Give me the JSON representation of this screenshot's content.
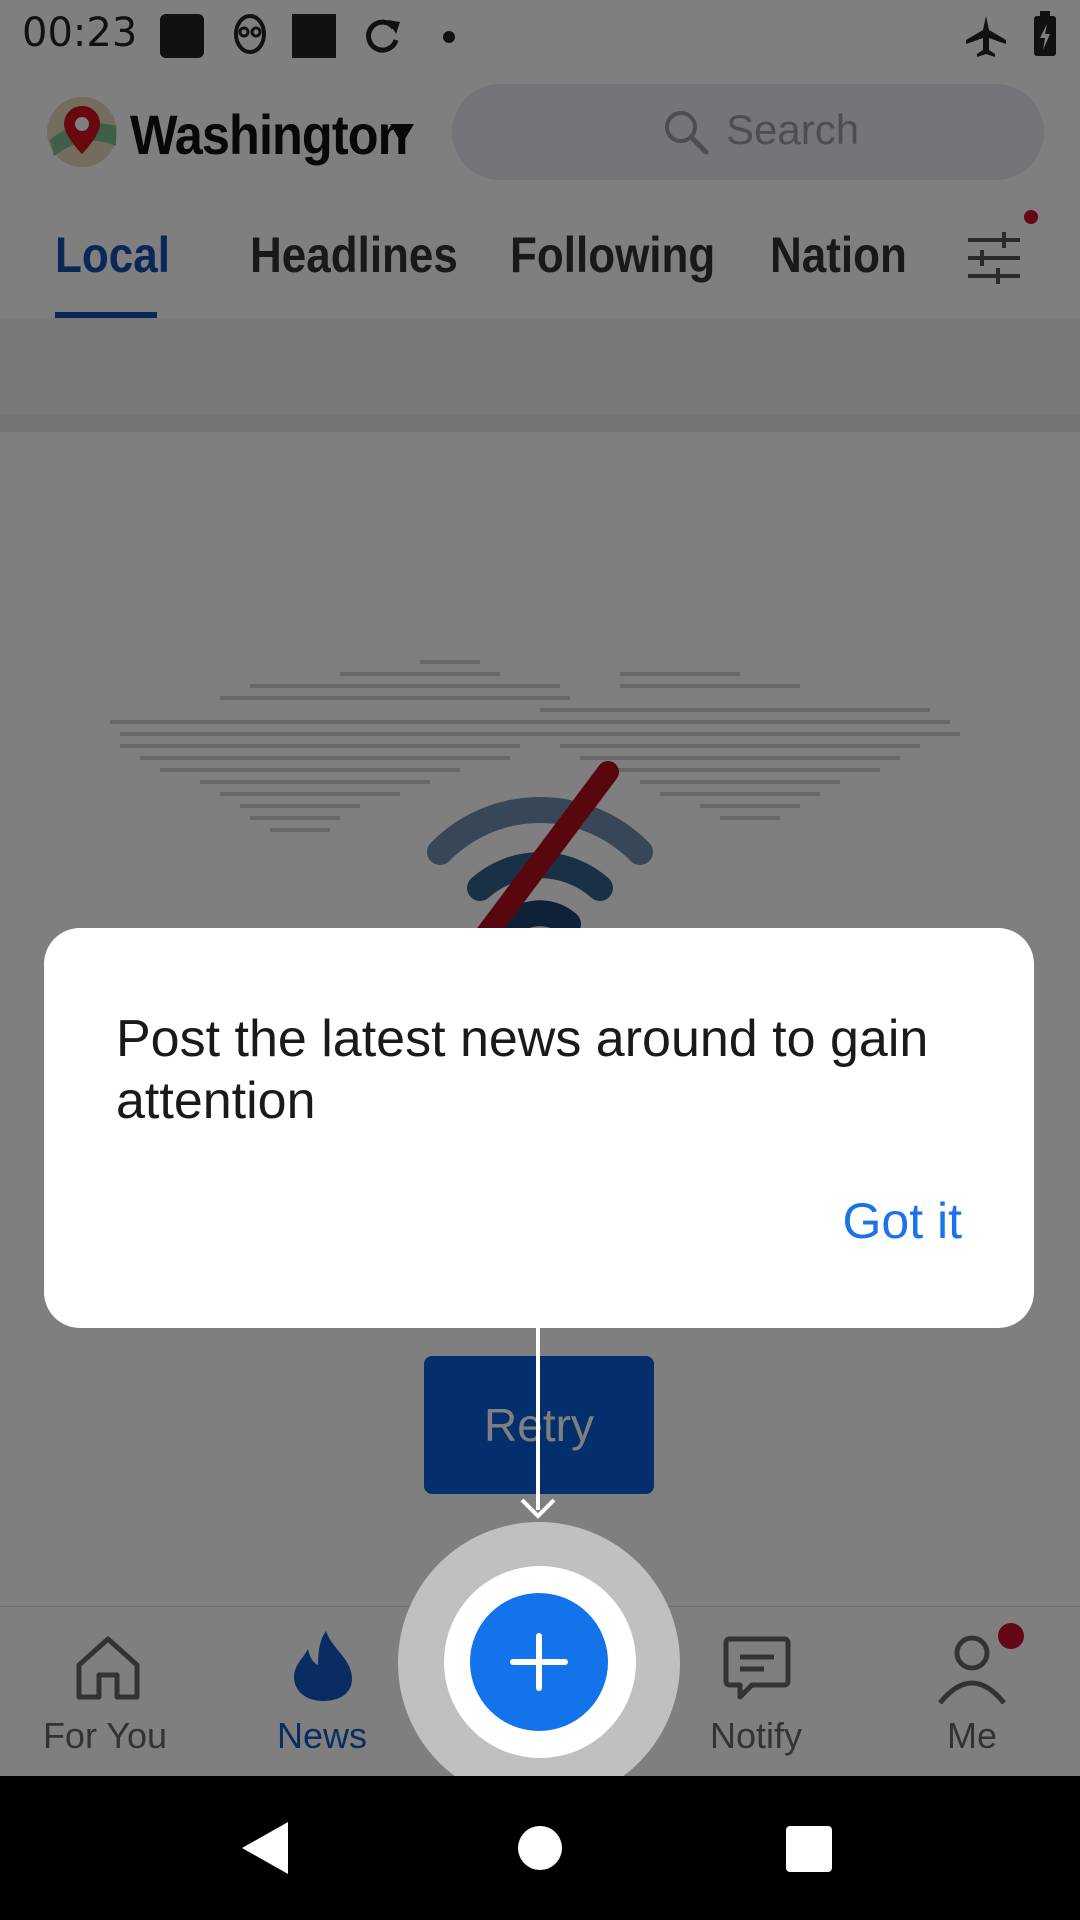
{
  "status_bar": {
    "time": "00:23"
  },
  "header": {
    "city": "Washington",
    "search_placeholder": "Search"
  },
  "tabs": [
    {
      "label": "Local",
      "active": true
    },
    {
      "label": "Headlines",
      "active": false
    },
    {
      "label": "Following",
      "active": false
    },
    {
      "label": "Nation",
      "active": false
    }
  ],
  "content": {
    "retry_label": "Retry"
  },
  "bottom_nav": {
    "for_you": "For You",
    "news": "News",
    "notify": "Notify",
    "me": "Me"
  },
  "dialog": {
    "message": "Post the latest news around to gain attention",
    "button": "Got it"
  },
  "colors": {
    "accent": "#1350b0",
    "fab": "#1273ea",
    "badge": "#c8102e"
  }
}
